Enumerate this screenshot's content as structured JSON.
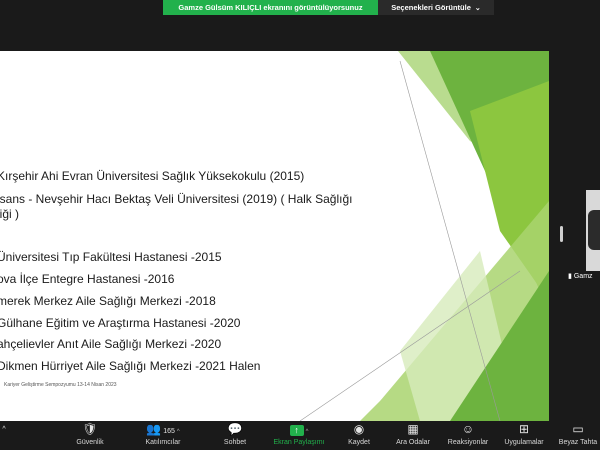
{
  "share_banner": {
    "text": "Gamze Gülsüm KILIÇLI ekranını görüntülüyorsunuz"
  },
  "view_options": {
    "label": "Seçenekleri Görüntüle",
    "icon": "chevron-down-icon"
  },
  "slide": {
    "lines": [
      "Kırşehir Ahi Evran Üniversitesi Sağlık Yüksekokulu (2015)",
      "isans - Nevşehir Hacı Bektaş Veli Üniversitesi (2019) ( Halk Sağlığı",
      "liği )",
      "Üniversitesi Tıp Fakültesi Hastanesi -2015",
      "ova İlçe Entegre Hastanesi -2016",
      "merek Merkez Aile Sağlığı Merkezi -2018",
      "Gülhane Eğitim ve Araştırma Hastanesi -2020",
      "ahçelievler Anıt Aile Sağlığı Merkezi -2020",
      "Dikmen Hürriyet Aile Sağlığı Merkezi -2021 Halen"
    ],
    "footer": "Kariyer Geliştirme Sempozyumu 13-14 Nisan 2023",
    "colors": {
      "green_dark": "#6db33f",
      "green_light": "#c9e3a4",
      "green_mid": "#8cc63f"
    }
  },
  "participant_thumb": {
    "name": "Gamz",
    "icon": "signal-bars-icon"
  },
  "toolbar": {
    "items": [
      {
        "label": "Güvenlik",
        "icon": "shield-icon"
      },
      {
        "label": "Katılımcılar",
        "icon": "participants-icon",
        "count": "165"
      },
      {
        "label": "Sohbet",
        "icon": "chat-icon"
      },
      {
        "label": "Ekran Paylaşımı",
        "icon": "share-screen-icon"
      },
      {
        "label": "Kaydet",
        "icon": "record-icon"
      },
      {
        "label": "Ara Odalar",
        "icon": "breakout-rooms-icon"
      },
      {
        "label": "Reaksiyonlar",
        "icon": "reactions-icon"
      },
      {
        "label": "Uygulamalar",
        "icon": "apps-icon"
      },
      {
        "label": "Beyaz Tahta",
        "icon": "whiteboard-icon"
      }
    ]
  }
}
